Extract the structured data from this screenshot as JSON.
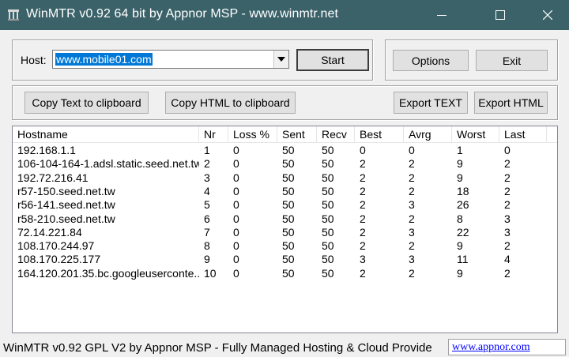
{
  "window": {
    "title": "WinMTR v0.92 64 bit by Appnor MSP - www.winmtr.net",
    "titlebar_color": "#3b6269"
  },
  "host": {
    "label": "Host:",
    "value": "www.mobile01.com"
  },
  "buttons": {
    "start": "Start",
    "options": "Options",
    "exit": "Exit",
    "copy_text": "Copy Text to clipboard",
    "copy_html": "Copy HTML to clipboard",
    "export_text": "Export TEXT",
    "export_html": "Export HTML"
  },
  "columns": [
    "Hostname",
    "Nr",
    "Loss %",
    "Sent",
    "Recv",
    "Best",
    "Avrg",
    "Worst",
    "Last"
  ],
  "rows": [
    {
      "hostname": "192.168.1.1",
      "nr": "1",
      "loss": "0",
      "sent": "50",
      "recv": "50",
      "best": "0",
      "avrg": "0",
      "worst": "1",
      "last": "0"
    },
    {
      "hostname": "106-104-164-1.adsl.static.seed.net.tw",
      "nr": "2",
      "loss": "0",
      "sent": "50",
      "recv": "50",
      "best": "2",
      "avrg": "2",
      "worst": "9",
      "last": "2"
    },
    {
      "hostname": "192.72.216.41",
      "nr": "3",
      "loss": "0",
      "sent": "50",
      "recv": "50",
      "best": "2",
      "avrg": "2",
      "worst": "9",
      "last": "2"
    },
    {
      "hostname": "r57-150.seed.net.tw",
      "nr": "4",
      "loss": "0",
      "sent": "50",
      "recv": "50",
      "best": "2",
      "avrg": "2",
      "worst": "18",
      "last": "2"
    },
    {
      "hostname": "r56-141.seed.net.tw",
      "nr": "5",
      "loss": "0",
      "sent": "50",
      "recv": "50",
      "best": "2",
      "avrg": "3",
      "worst": "26",
      "last": "2"
    },
    {
      "hostname": "r58-210.seed.net.tw",
      "nr": "6",
      "loss": "0",
      "sent": "50",
      "recv": "50",
      "best": "2",
      "avrg": "2",
      "worst": "8",
      "last": "3"
    },
    {
      "hostname": "72.14.221.84",
      "nr": "7",
      "loss": "0",
      "sent": "50",
      "recv": "50",
      "best": "2",
      "avrg": "3",
      "worst": "22",
      "last": "3"
    },
    {
      "hostname": "108.170.244.97",
      "nr": "8",
      "loss": "0",
      "sent": "50",
      "recv": "50",
      "best": "2",
      "avrg": "2",
      "worst": "9",
      "last": "2"
    },
    {
      "hostname": "108.170.225.177",
      "nr": "9",
      "loss": "0",
      "sent": "50",
      "recv": "50",
      "best": "3",
      "avrg": "3",
      "worst": "11",
      "last": "4"
    },
    {
      "hostname": "164.120.201.35.bc.googleuserconte...",
      "nr": "10",
      "loss": "0",
      "sent": "50",
      "recv": "50",
      "best": "2",
      "avrg": "2",
      "worst": "9",
      "last": "2"
    }
  ],
  "status": {
    "text": "WinMTR v0.92 GPL V2 by Appnor MSP - Fully Managed Hosting & Cloud Provide",
    "link": "www.appnor.com"
  }
}
